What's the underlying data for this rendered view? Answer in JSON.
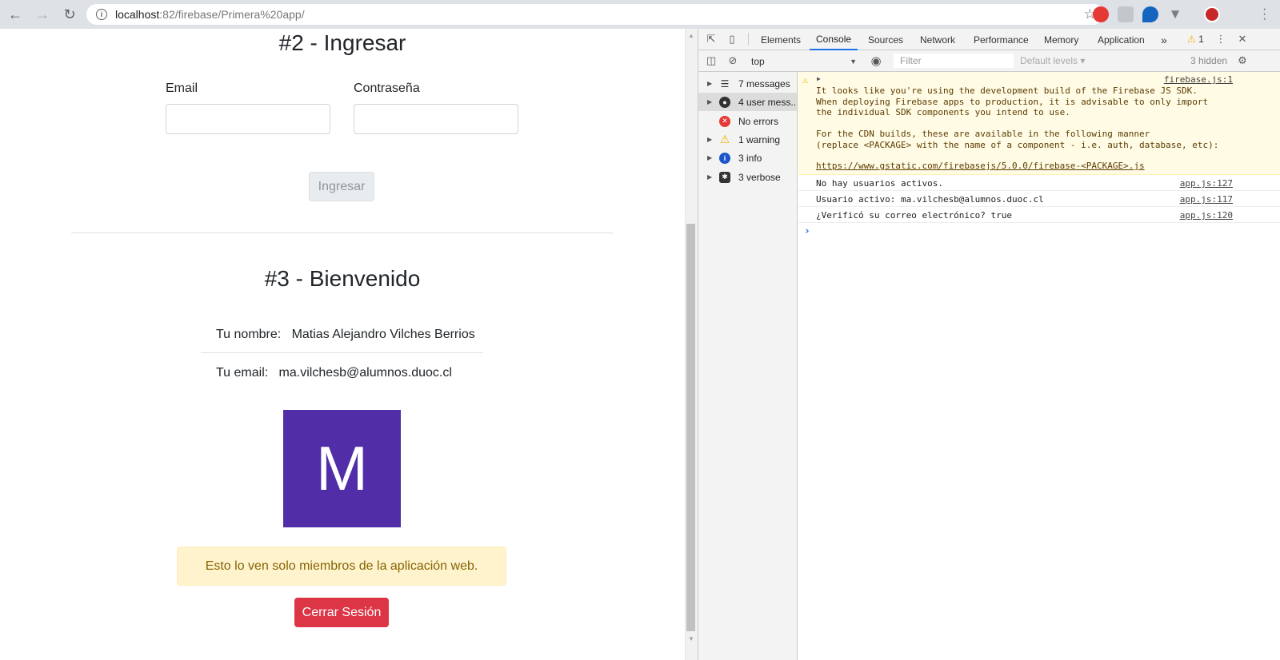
{
  "browser": {
    "url_host": "localhost",
    "url_rest": ":82/firebase/Primera%20app/"
  },
  "page": {
    "section2_title": "#2 - Ingresar",
    "email_label": "Email",
    "password_label": "Contraseña",
    "email_value": "",
    "password_value": "",
    "login_button": "Ingresar",
    "section3_title": "#3 - Bienvenido",
    "name_label": "Tu nombre:",
    "name_value": "Matias Alejandro Vilches Berrios",
    "email_label2": "Tu email:",
    "email_value2": "ma.vilchesb@alumnos.duoc.cl",
    "avatar_letter": "M",
    "avatar_color": "#512da8",
    "alert_text": "Esto lo ven solo miembros de la aplicación web.",
    "logout_button": "Cerrar Sesión"
  },
  "devtools": {
    "tabs": [
      "Elements",
      "Console",
      "Sources",
      "Network",
      "Performance",
      "Memory",
      "Application"
    ],
    "active_tab": "Console",
    "more_tabs": "»",
    "warning_count": "1",
    "context": "top",
    "filter_placeholder": "Filter",
    "levels": "Default levels ▾",
    "hidden_count": "3 hidden",
    "sidebar": [
      {
        "label": "7 messages",
        "icon": "list-icon"
      },
      {
        "label": "4 user mess...",
        "icon": "user-icon"
      },
      {
        "label": "No errors",
        "icon": "error-icon"
      },
      {
        "label": "1 warning",
        "icon": "warning-icon"
      },
      {
        "label": "3 info",
        "icon": "info-icon"
      },
      {
        "label": "3 verbose",
        "icon": "bug-icon"
      }
    ],
    "messages": {
      "warning_text": "It looks like you're using the development build of the Firebase JS SDK.\nWhen deploying Firebase apps to production, it is advisable to only import\nthe individual SDK components you intend to use.\n\nFor the CDN builds, these are available in the following manner\n(replace <PACKAGE> with the name of a component - i.e. auth, database, etc):",
      "warning_link": "https://www.gstatic.com/firebasejs/5.0.0/firebase-<PACKAGE>.js",
      "warning_source": "firebase.js:1",
      "log1_text": "No hay usuarios activos.",
      "log1_source": "app.js:127",
      "log2_text": "Usuario activo: ma.vilchesb@alumnos.duoc.cl",
      "log2_source": "app.js:117",
      "log3_text": "¿Verificó su correo electrónico? true",
      "log3_source": "app.js:120"
    }
  }
}
